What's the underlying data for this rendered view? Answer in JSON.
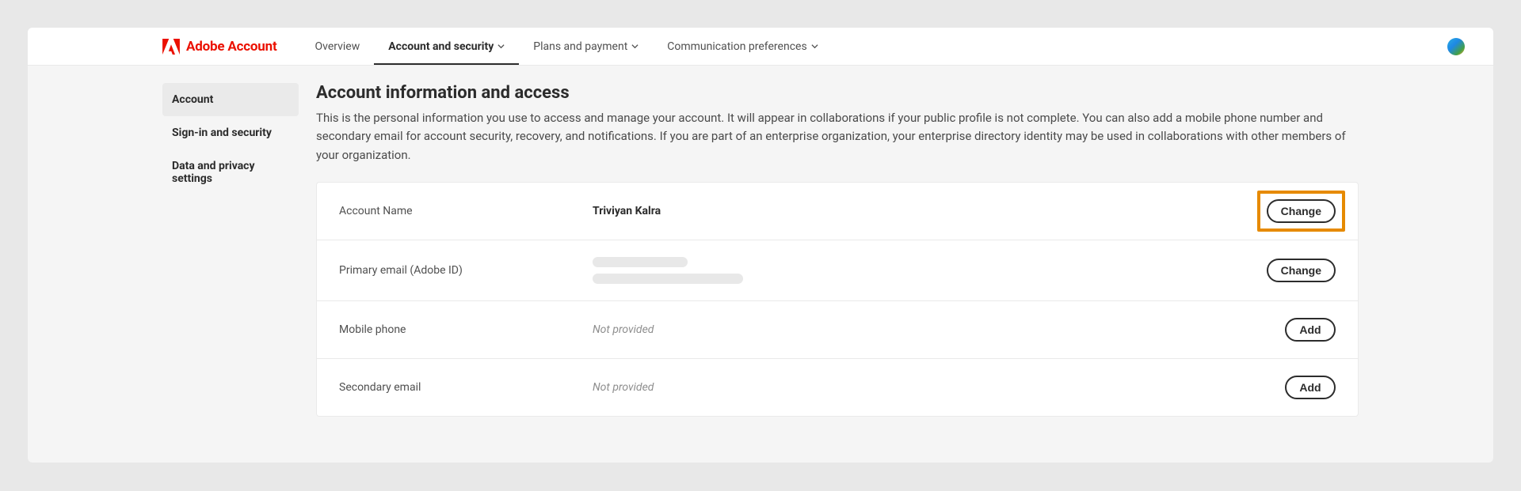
{
  "brand": {
    "text": "Adobe Account"
  },
  "nav": {
    "items": [
      {
        "label": "Overview",
        "hasDropdown": false,
        "active": false
      },
      {
        "label": "Account and security",
        "hasDropdown": true,
        "active": true
      },
      {
        "label": "Plans and payment",
        "hasDropdown": true,
        "active": false
      },
      {
        "label": "Communication preferences",
        "hasDropdown": true,
        "active": false
      }
    ]
  },
  "sidebar": {
    "items": [
      {
        "label": "Account",
        "active": true
      },
      {
        "label": "Sign-in and security",
        "active": false
      },
      {
        "label": "Data and privacy settings",
        "active": false
      }
    ]
  },
  "page": {
    "title": "Account information and access",
    "description": "This is the personal information you use to access and manage your account. It will appear in collaborations if your public profile is not complete. You can also add a mobile phone number and secondary email for account security, recovery, and notifications. If you are part of an enterprise organization, your enterprise directory identity may be used in collaborations with other members of your organization."
  },
  "rows": {
    "accountName": {
      "label": "Account Name",
      "value": "Triviyan Kalra",
      "action": "Change",
      "highlighted": true
    },
    "primaryEmail": {
      "label": "Primary email (Adobe ID)",
      "redacted": true,
      "action": "Change"
    },
    "mobilePhone": {
      "label": "Mobile phone",
      "value": "Not provided",
      "placeholder": true,
      "action": "Add"
    },
    "secondaryEmail": {
      "label": "Secondary email",
      "value": "Not provided",
      "placeholder": true,
      "action": "Add"
    }
  }
}
